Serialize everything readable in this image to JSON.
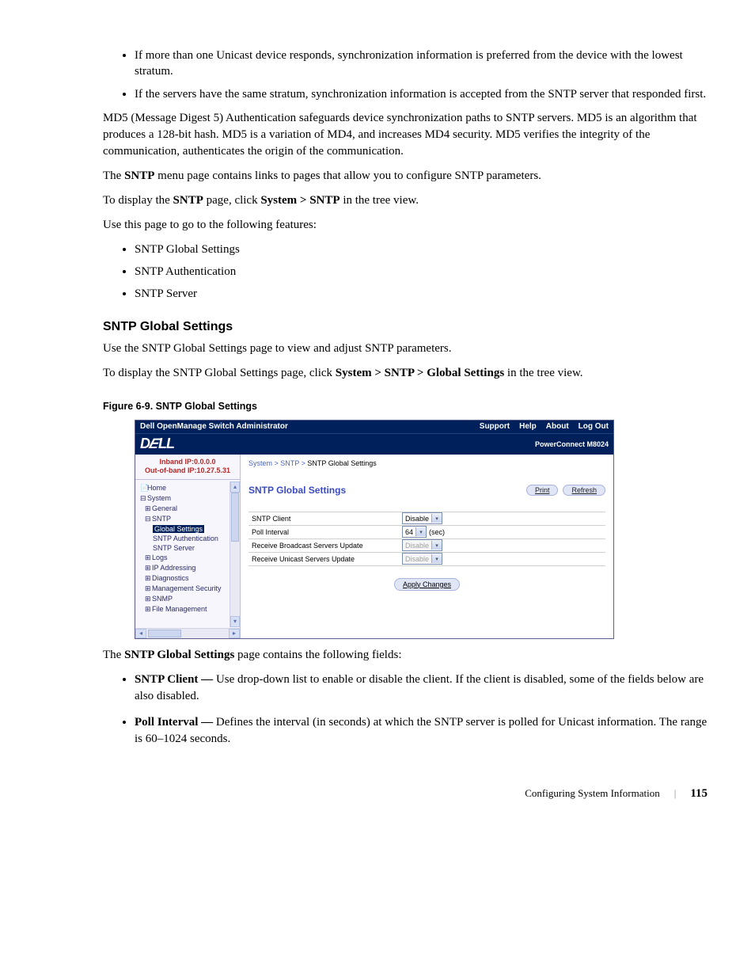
{
  "bullets_top": [
    "If more than one Unicast device responds, synchronization information is preferred from the device with the lowest stratum.",
    "If the servers have the same stratum, synchronization information is accepted from the SNTP server that responded first."
  ],
  "para_md5": "MD5 (Message Digest 5) Authentication safeguards device synchronization paths to SNTP servers. MD5 is an algorithm that produces a 128-bit hash. MD5 is a variation of MD4, and increases MD4 security. MD5 verifies the integrity of the communication, authenticates the origin of the communication.",
  "para_menu_pre": "The ",
  "para_menu_bold": "SNTP",
  "para_menu_post": " menu page contains links to pages that allow you to configure SNTP parameters.",
  "para_display_pre": "To display the ",
  "para_display_bold1": "SNTP",
  "para_display_mid": " page, click ",
  "para_display_bold2": "System > SNTP",
  "para_display_post": " in the tree view.",
  "para_usepage": "Use this page to go to the following features:",
  "features": [
    "SNTP Global Settings",
    "SNTP Authentication",
    "SNTP Server"
  ],
  "heading_sgs": "SNTP Global Settings",
  "para_sgs_intro": "Use the SNTP Global Settings page to view and adjust SNTP parameters.",
  "para_sgs_display_pre": "To display the SNTP Global Settings page, click ",
  "para_sgs_display_bold": "System > SNTP > Global Settings",
  "para_sgs_display_post": " in the tree view.",
  "fig_caption": "Figure 6-9.    SNTP Global Settings",
  "shot": {
    "title": "Dell OpenManage Switch Administrator",
    "nav": [
      "Support",
      "Help",
      "About",
      "Log Out"
    ],
    "brand": "DELL",
    "product": "PowerConnect M8024",
    "ips": {
      "inband": "Inband IP:0.0.0.0",
      "oob": "Out-of-band IP:10.27.5.31"
    },
    "tree": {
      "home": "Home",
      "system": "System",
      "general": "General",
      "sntp": "SNTP",
      "global_settings": "Global Settings",
      "sntp_auth": "SNTP Authentication",
      "sntp_server": "SNTP Server",
      "logs": "Logs",
      "ip_addr": "IP Addressing",
      "diag": "Diagnostics",
      "mgmt_sec": "Management Security",
      "snmp": "SNMP",
      "file_mgmt": "File Management"
    },
    "crumbs": {
      "a": "System",
      "b": "SNTP",
      "c": "SNTP Global Settings"
    },
    "panel_title": "SNTP Global Settings",
    "btn_print": "Print",
    "btn_refresh": "Refresh",
    "rows": {
      "client": {
        "label": "SNTP Client",
        "value": "Disable"
      },
      "poll": {
        "label": "Poll Interval",
        "value": "64",
        "unit": "(sec)"
      },
      "bcast": {
        "label": "Receive Broadcast Servers Update",
        "value": "Disable"
      },
      "ucast": {
        "label": "Receive Unicast Servers Update",
        "value": "Disable"
      }
    },
    "btn_apply": "Apply Changes"
  },
  "para_fields_pre": "The ",
  "para_fields_bold": "SNTP Global Settings",
  "para_fields_post": " page contains the following fields:",
  "fields": {
    "f1_bold": "SNTP Client — ",
    "f1_text": "Use drop-down list to enable or disable the client. If the client is disabled, some of the fields below are also disabled.",
    "f2_bold": "Poll Interval — ",
    "f2_text": "Defines the interval (in seconds) at which the SNTP server is polled for Unicast information. The range is 60–1024 seconds."
  },
  "footer": {
    "section": "Configuring System Information",
    "page": "115"
  }
}
